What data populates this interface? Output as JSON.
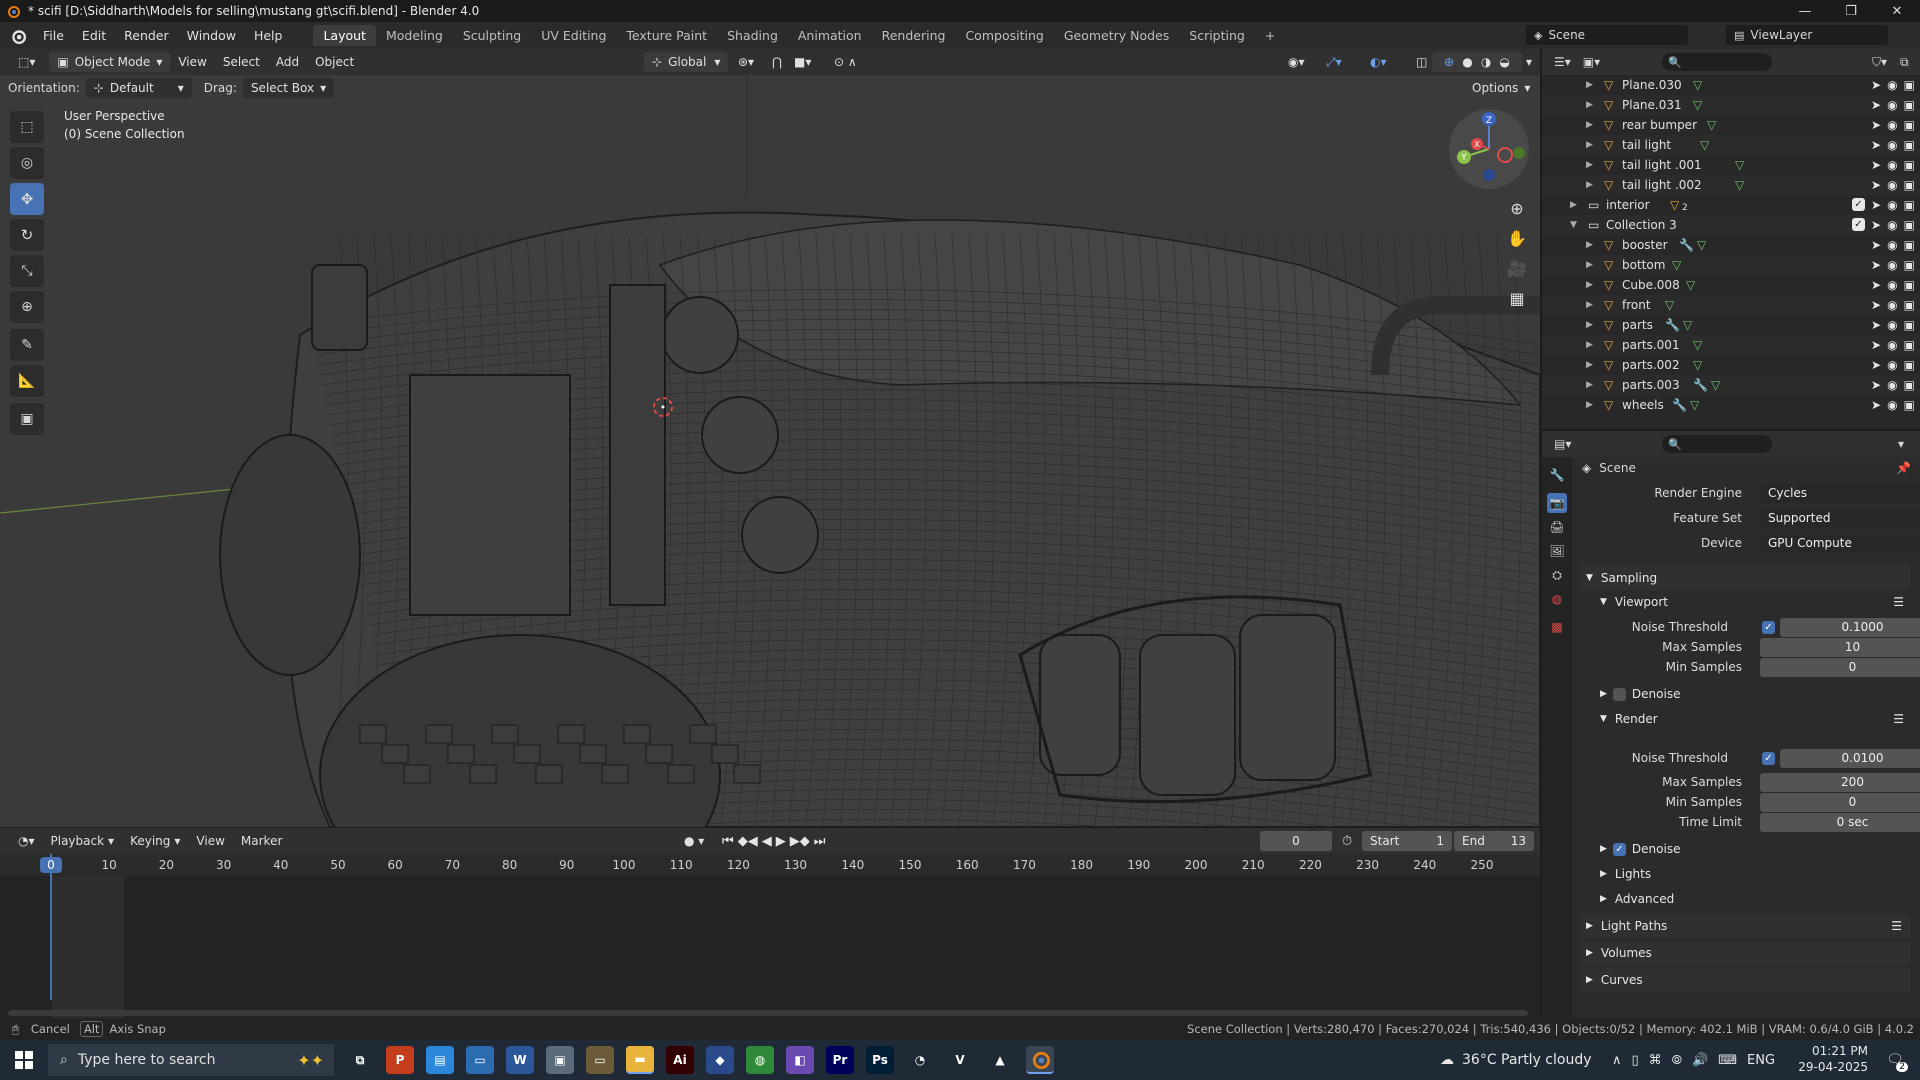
{
  "titlebar": {
    "title": "* scifi [D:\\Siddharth\\Models for selling\\mustang gt\\scifi.blend] - Blender 4.0",
    "min": "—",
    "max": "❐",
    "close": "✕"
  },
  "menu": {
    "items": [
      "File",
      "Edit",
      "Render",
      "Window",
      "Help"
    ]
  },
  "workspaces": {
    "tabs": [
      "Layout",
      "Modeling",
      "Sculpting",
      "UV Editing",
      "Texture Paint",
      "Shading",
      "Animation",
      "Rendering",
      "Compositing",
      "Geometry Nodes",
      "Scripting"
    ],
    "active": "Layout",
    "add": "+"
  },
  "scene": {
    "label": "Scene",
    "viewlayer": "ViewLayer"
  },
  "viewport_header": {
    "mode": "Object Mode",
    "view": "View",
    "select": "Select",
    "add": "Add",
    "object": "Object",
    "transform_orientation": "Global",
    "options": "Options",
    "orientation_label": "Orientation:",
    "orientation_value": "Default",
    "drag_label": "Drag:",
    "drag_value": "Select Box"
  },
  "viewport": {
    "perspective": "User Perspective",
    "collection": "(0) Scene Collection",
    "gizmo_z": "Z",
    "gizmo_y": "Y",
    "gizmo_x": "X"
  },
  "timeline": {
    "playback": "Playback",
    "keying": "Keying",
    "view": "View",
    "marker": "Marker",
    "current_frame": "0",
    "start_label": "Start",
    "start": "1",
    "end_label": "End",
    "end": "13",
    "ticks": [
      "0",
      "10",
      "20",
      "30",
      "40",
      "50",
      "60",
      "70",
      "80",
      "90",
      "100",
      "110",
      "120",
      "130",
      "140",
      "150",
      "160",
      "170",
      "180",
      "190",
      "200",
      "210",
      "220",
      "230",
      "240",
      "250"
    ]
  },
  "statusbar": {
    "cancel": "Cancel",
    "alt": "Alt",
    "axis_snap": "Axis Snap",
    "stats": "Scene Collection | Verts:280,470 | Faces:270,024 | Tris:540,436 | Objects:0/52 | Memory: 402.1 MiB | VRAM: 0.6/4.0 GiB | 4.0.2"
  },
  "outliner": {
    "search_placeholder": "",
    "rows": [
      {
        "name": "Plane.030",
        "indent": 2,
        "type": "mesh"
      },
      {
        "name": "Plane.031",
        "indent": 2,
        "type": "mesh"
      },
      {
        "name": "rear bumper",
        "indent": 2,
        "type": "mesh"
      },
      {
        "name": "tail light",
        "indent": 2,
        "type": "mesh"
      },
      {
        "name": "tail light .001",
        "indent": 2,
        "type": "mesh"
      },
      {
        "name": "tail light .002",
        "indent": 2,
        "type": "mesh"
      },
      {
        "name": "interior",
        "indent": 1,
        "type": "collection",
        "badge": "2"
      },
      {
        "name": "Collection 3",
        "indent": 1,
        "type": "collection"
      },
      {
        "name": "booster",
        "indent": 2,
        "type": "mesh"
      },
      {
        "name": "bottom",
        "indent": 2,
        "type": "mesh"
      },
      {
        "name": "Cube.008",
        "indent": 2,
        "type": "mesh"
      },
      {
        "name": "front",
        "indent": 2,
        "type": "mesh"
      },
      {
        "name": "parts",
        "indent": 2,
        "type": "mesh"
      },
      {
        "name": "parts.001",
        "indent": 2,
        "type": "mesh"
      },
      {
        "name": "parts.002",
        "indent": 2,
        "type": "mesh"
      },
      {
        "name": "parts.003",
        "indent": 2,
        "type": "mesh"
      },
      {
        "name": "wheels",
        "indent": 2,
        "type": "mesh"
      }
    ]
  },
  "properties": {
    "context": "Scene",
    "render_engine_label": "Render Engine",
    "render_engine": "Cycles",
    "feature_set_label": "Feature Set",
    "feature_set": "Supported",
    "device_label": "Device",
    "device": "GPU Compute",
    "sampling": "Sampling",
    "viewport": "Viewport",
    "noise_threshold_label": "Noise Threshold",
    "vp_noise": "0.1000",
    "max_samples_label": "Max Samples",
    "vp_max": "10",
    "min_samples_label": "Min Samples",
    "vp_min": "0",
    "denoise": "Denoise",
    "render": "Render",
    "r_noise": "0.0100",
    "r_max": "200",
    "r_min": "0",
    "time_limit_label": "Time Limit",
    "r_time": "0 sec",
    "lights": "Lights",
    "advanced": "Advanced",
    "light_paths": "Light Paths",
    "volumes": "Volumes",
    "curves": "Curves"
  },
  "taskbar": {
    "search_placeholder": "Type here to search",
    "weather": "36°C  Partly cloudy",
    "lang": "ENG",
    "time": "01:21 PM",
    "date": "29-04-2025",
    "notif": "2",
    "apps": [
      "P",
      "",
      "",
      "W",
      "",
      "",
      "",
      "Ai",
      "",
      "",
      "",
      "Pr",
      "Ps",
      "",
      "",
      "",
      ""
    ]
  },
  "colors": {
    "accent": "#4772b3",
    "mesh": "#e8a33b",
    "modifier": "#5aa0e8"
  }
}
